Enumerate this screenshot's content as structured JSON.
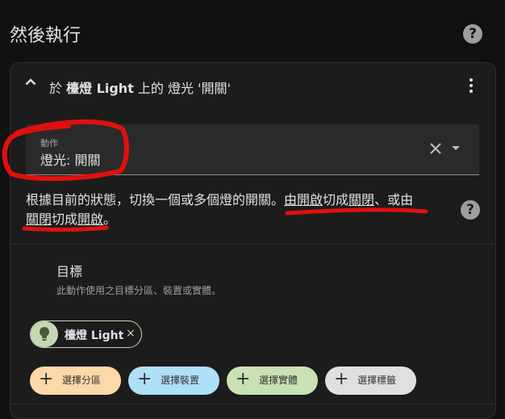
{
  "section": {
    "title": "然後執行",
    "help": "?"
  },
  "card": {
    "title_prefix": "於 ",
    "title_device": "檯燈 Light",
    "title_suffix": " 上的 燈光 '開關'"
  },
  "action_select": {
    "label": "動作",
    "value": "燈光: 開關"
  },
  "description": {
    "part1": "根據目前的狀態，切換一個或多個燈的開關。",
    "part2_under": "由開啟",
    "part3": "切成",
    "part4_under": "關閉",
    "part5": "、或由",
    "part6_under": "關閉",
    "part7": "切成",
    "part8_under": "開啟",
    "part9": "。",
    "help": "?"
  },
  "target": {
    "title": "目標",
    "subtitle": "此動作使用之目標分區、裝置或實體。",
    "chip_label": "檯燈 Light",
    "chip_remove": "×",
    "buttons": [
      "選擇分區",
      "選擇裝置",
      "選擇實體",
      "選擇標籤"
    ],
    "plus": "+"
  },
  "colors": {
    "area": "#fdd9a9",
    "device": "#aee0f8",
    "entity": "#c8e2b4",
    "label": "#e0e0e0",
    "annotation": "#e01010"
  }
}
